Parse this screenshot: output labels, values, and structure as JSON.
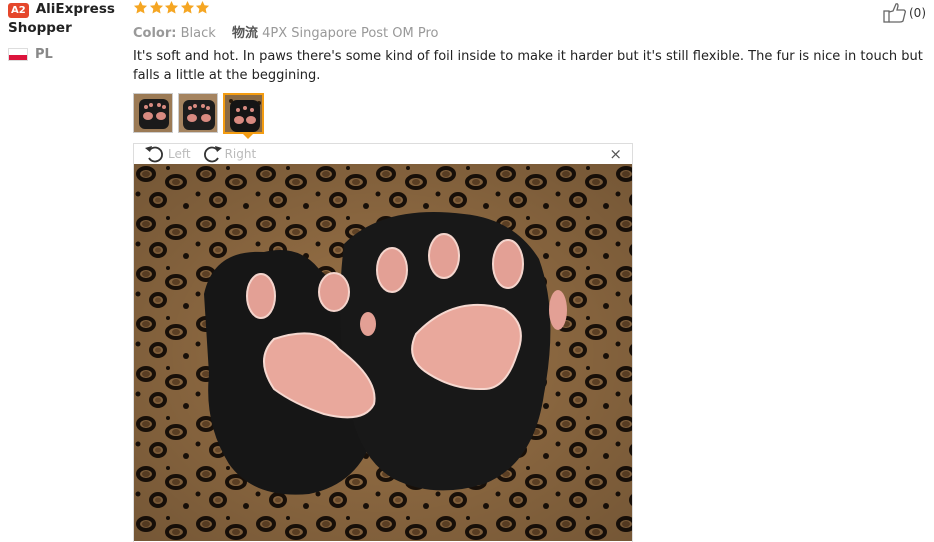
{
  "user": {
    "badge": "A2",
    "name_line1": "AliExpress",
    "name_line2": "Shopper",
    "country": "PL"
  },
  "review": {
    "rating": 5,
    "color_key": "Color:",
    "color_value": "Black",
    "shipping_key": "物流",
    "shipping_value": "4PX Singapore Post OM Pro",
    "text": "It's soft and hot. In paws there's some kind of foil inside to make it harder but it's still flexible. The fur is nice in touch but falls a little at the beggining.",
    "helpful_count": "(0)"
  },
  "viewer": {
    "rotate_left_label": "Left",
    "rotate_right_label": "Right",
    "close_glyph": "×"
  },
  "colors": {
    "star": "#f5a623",
    "badge": "#e5472c",
    "active_thumb_border": "#f39c12"
  },
  "icons": [
    "star-icon",
    "thumbs-up-icon",
    "rotate-left-icon",
    "rotate-right-icon",
    "close-icon",
    "poland-flag-icon"
  ]
}
